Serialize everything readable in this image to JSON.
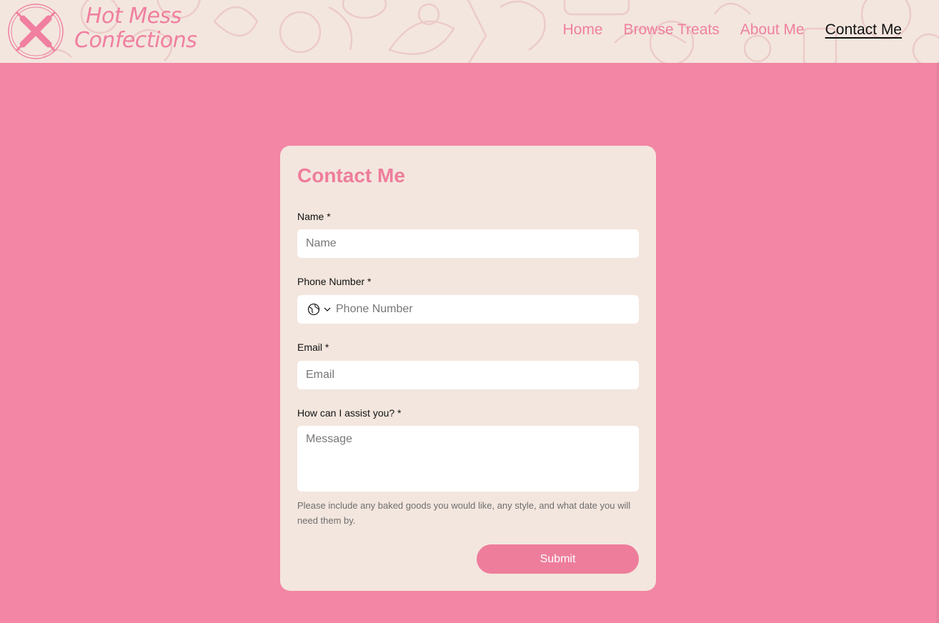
{
  "site": {
    "brand_line1": "Hot Mess",
    "brand_line2": "Confections",
    "logo_icon": "crossed-rolling-pins-icon",
    "accent_color": "#f07fa0",
    "page_background": "#f286a4",
    "header_background": "#f3e6de"
  },
  "nav": {
    "items": [
      {
        "label": "Home"
      },
      {
        "label": "Browse Treats"
      },
      {
        "label": "About Me"
      },
      {
        "label": "Contact Me",
        "active": true
      }
    ]
  },
  "form": {
    "title": "Contact Me",
    "name_label": "Name *",
    "name_placeholder": "Name",
    "phone_label": "Phone Number *",
    "phone_placeholder": "Phone Number",
    "country_icon": "globe-icon",
    "email_label": "Email *",
    "email_placeholder": "Email",
    "message_label": "How can I assist you? *",
    "message_placeholder": "Message",
    "help_text": "Please include any baked goods you would like, any style, and what date you will need them by.",
    "submit_label": "Submit"
  }
}
